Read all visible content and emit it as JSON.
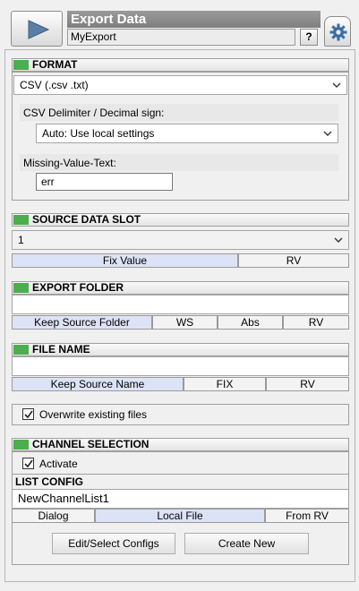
{
  "header": {
    "title": "Export Data",
    "name_value": "MyExport",
    "help_label": "?"
  },
  "format": {
    "section_title": "FORMAT",
    "selected_format": "CSV  (.csv .txt)",
    "delimiter_label": "CSV Delimiter / Decimal sign:",
    "delimiter_value": "Auto: Use local settings",
    "missing_label": "Missing-Value-Text:",
    "missing_value": "err"
  },
  "source": {
    "section_title": "SOURCE DATA SLOT",
    "slot_value": "1",
    "tabs": [
      "Fix Value",
      "RV"
    ]
  },
  "folder": {
    "section_title": "EXPORT FOLDER",
    "value": "",
    "tabs": [
      "Keep Source Folder",
      "WS",
      "Abs",
      "RV"
    ]
  },
  "filename": {
    "section_title": "FILE NAME",
    "value": "",
    "tabs": [
      "Keep Source Name",
      "FIX",
      "RV"
    ]
  },
  "overwrite": {
    "label": "Overwrite existing files",
    "checked": true
  },
  "channels": {
    "section_title": "CHANNEL SELECTION",
    "activate_label": "Activate",
    "activate_checked": true,
    "list_config_label": "LIST CONFIG",
    "list_name": "NewChannelList1",
    "tabs": [
      "Dialog",
      "Local File",
      "From RV"
    ],
    "edit_button": "Edit/Select Configs",
    "create_button": "Create New"
  },
  "colors": {
    "section_stripe": "#4cae4c",
    "title_bar": "#8a8a8a",
    "selected_tab": "#dde3f7"
  },
  "icons": {
    "play": "play-icon",
    "gear": "gear-icon",
    "dropdown": "chevron-down-icon",
    "check": "check-icon"
  }
}
